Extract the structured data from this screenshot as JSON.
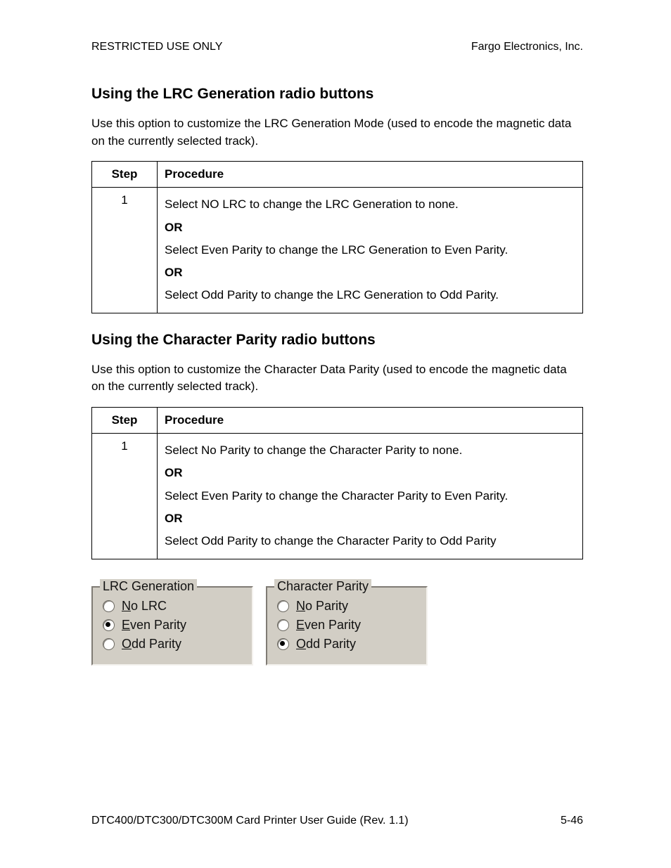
{
  "header": {
    "left": "RESTRICTED USE ONLY",
    "right": "Fargo Electronics, Inc."
  },
  "section1": {
    "heading": "Using the LRC Generation radio buttons",
    "intro": "Use this option to customize the LRC Generation Mode (used to encode the magnetic data on the currently selected track).",
    "table": {
      "col1": "Step",
      "col2": "Procedure",
      "step": "1",
      "line1": "Select NO LRC to change the LRC Generation to none.",
      "or1": "OR",
      "line2": "Select Even Parity to change the LRC Generation to Even Parity.",
      "or2": "OR",
      "line3": "Select Odd Parity to change the LRC Generation to Odd Parity."
    }
  },
  "section2": {
    "heading": "Using the Character Parity radio buttons",
    "intro": "Use this option to customize the Character Data Parity (used to encode the magnetic data on the currently selected track).",
    "table": {
      "col1": "Step",
      "col2": "Procedure",
      "step": "1",
      "line1": "Select No Parity to change the Character Parity to none.",
      "or1": "OR",
      "line2": "Select Even Parity to change the Character Parity to Even Parity.",
      "or2": "OR",
      "line3": "Select Odd Parity to change the Character Parity to Odd Parity"
    }
  },
  "ui": {
    "lrc": {
      "legend": "LRC Generation",
      "opt1_u": "N",
      "opt1_rest": "o LRC",
      "opt2_u": "E",
      "opt2_rest": "ven Parity",
      "opt3_u": "O",
      "opt3_rest": "dd Parity",
      "selected": "even"
    },
    "cp": {
      "legend": "Character Parity",
      "opt1_u": "N",
      "opt1_rest": "o Parity",
      "opt2_u": "E",
      "opt2_rest": "ven Parity",
      "opt3_u": "O",
      "opt3_rest": "dd Parity",
      "selected": "odd"
    }
  },
  "footer": {
    "left": "DTC400/DTC300/DTC300M Card Printer User Guide (Rev. 1.1)",
    "right": "5-46"
  }
}
